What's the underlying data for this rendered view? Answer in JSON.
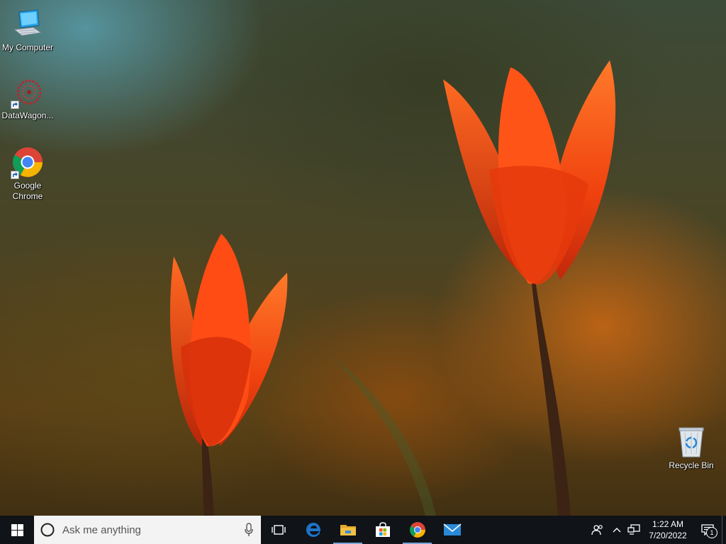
{
  "desktop": {
    "icons": [
      {
        "label": "My Computer",
        "icon": "computer-icon"
      },
      {
        "label": "DataWagon...",
        "icon": "datawagon-icon"
      },
      {
        "label": "Google Chrome",
        "icon": "chrome-icon"
      },
      {
        "label": "Recycle Bin",
        "icon": "recycle-bin-icon"
      }
    ]
  },
  "taskbar": {
    "search_placeholder": "Ask me anything",
    "pinned": [
      {
        "icon": "task-view-icon"
      },
      {
        "icon": "edge-icon"
      },
      {
        "icon": "file-explorer-icon"
      },
      {
        "icon": "store-icon"
      },
      {
        "icon": "chrome-icon"
      },
      {
        "icon": "mail-icon"
      }
    ],
    "clock": {
      "time": "1:22 AM",
      "date": "7/20/2022"
    },
    "notification_count": "1"
  },
  "colors": {
    "taskbar_bg": "#101318",
    "search_bg": "#f3f3f3",
    "edge_blue": "#1e73c8",
    "folder_yellow": "#f2c040"
  }
}
